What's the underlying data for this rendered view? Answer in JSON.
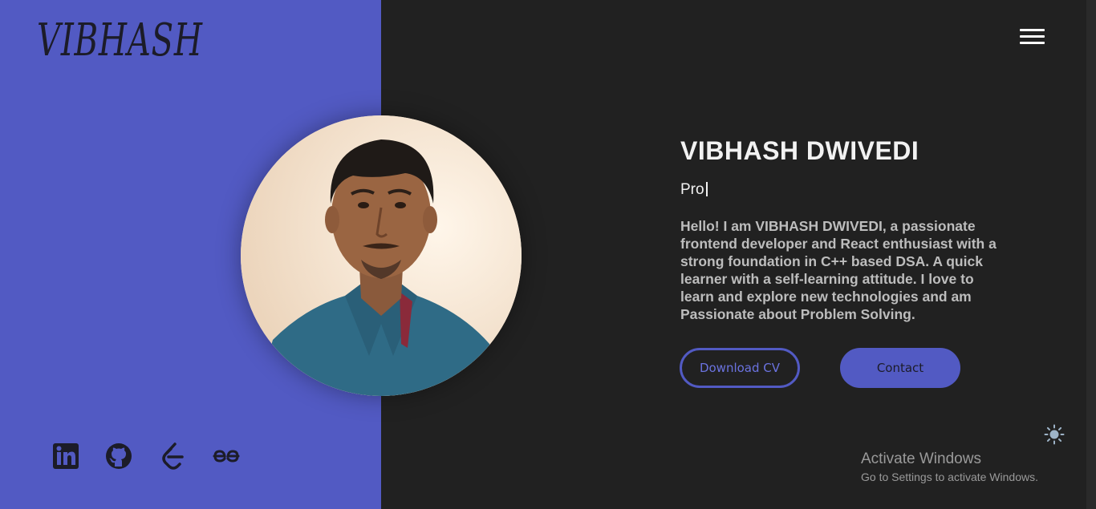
{
  "header": {
    "logo_text": "VIBHASH",
    "menu_icon": "hamburger-menu-icon"
  },
  "profile": {
    "photo_icon": "profile-photo",
    "name": "VIBHASH DWIVEDI",
    "typed_text": "Pro",
    "bio": "Hello! I am VIBHASH DWIVEDI, a passionate frontend developer and React enthusiast with a strong foundation in C++ based DSA. A quick learner with a self-learning attitude. I love to learn and explore new technologies and am Passionate about Problem Solving."
  },
  "buttons": {
    "download_cv": "Download CV",
    "contact": "Contact"
  },
  "social": [
    {
      "name": "linkedin-icon"
    },
    {
      "name": "github-icon"
    },
    {
      "name": "leetcode-icon"
    },
    {
      "name": "geeksforgeeks-icon"
    }
  ],
  "theme_toggle": "sun-icon",
  "windows_watermark": {
    "title": "Activate Windows",
    "subtitle": "Go to Settings to activate Windows."
  },
  "colors": {
    "accent": "#525ac3",
    "dark_bg": "#212121",
    "text_light": "#f2f2f2",
    "text_muted": "#bdbdbd"
  }
}
